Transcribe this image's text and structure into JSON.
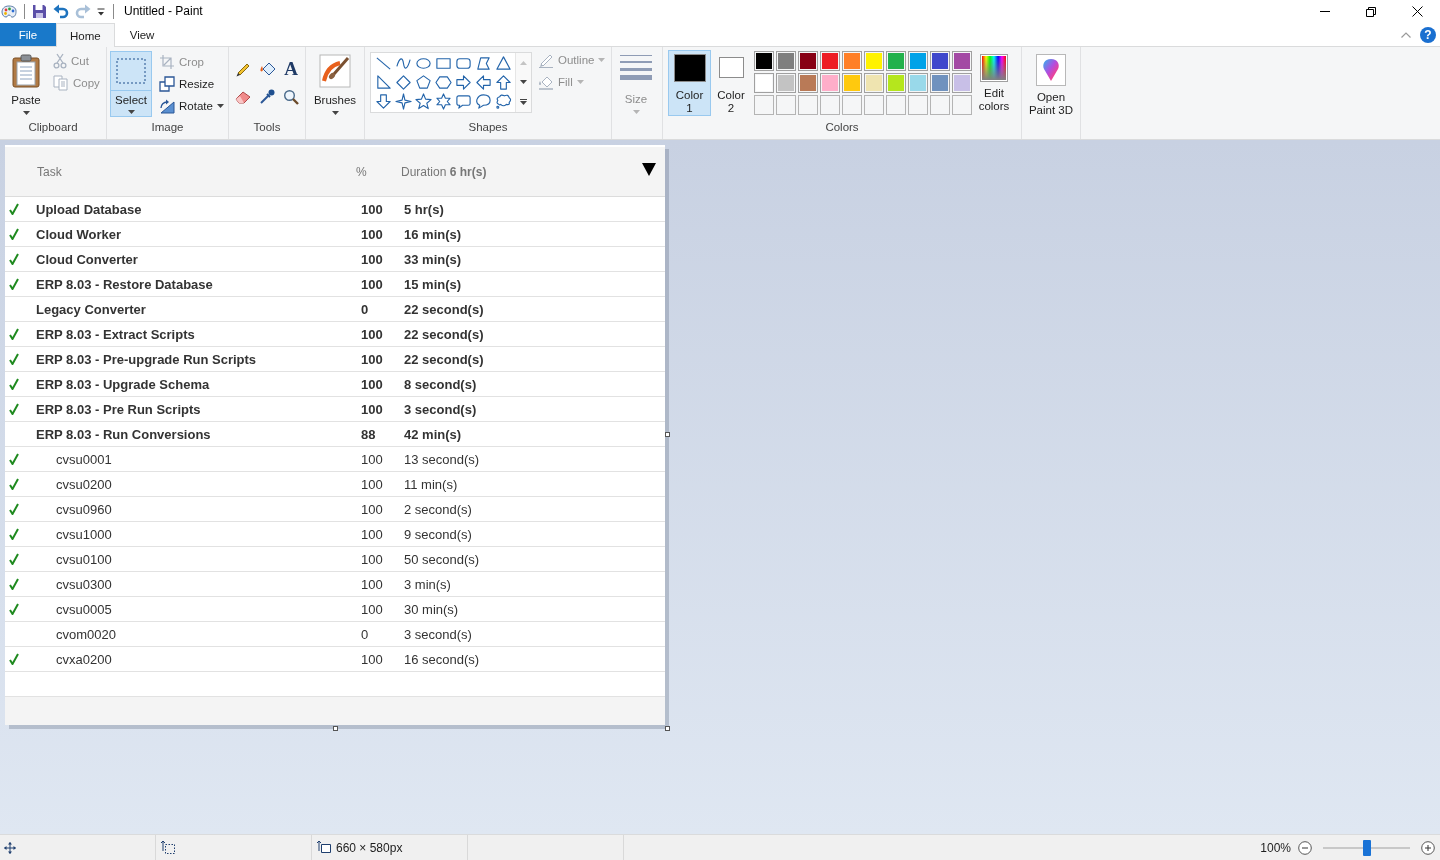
{
  "title_bar": {
    "title": "Untitled - Paint"
  },
  "menu_tabs": [
    {
      "label": "File",
      "kind": "file",
      "selected": false
    },
    {
      "label": "Home",
      "kind": "tab",
      "selected": true
    },
    {
      "label": "View",
      "kind": "tab",
      "selected": false
    }
  ],
  "help": "?",
  "clipboard": {
    "label": "Clipboard",
    "paste": "Paste",
    "tools": [
      {
        "kind": "cut",
        "label": "Cut",
        "disabled": true
      },
      {
        "kind": "copy",
        "label": "Copy",
        "disabled": true
      }
    ]
  },
  "image": {
    "label": "Image",
    "select": {
      "label": "Select",
      "selected": true
    },
    "tools": [
      {
        "kind": "crop",
        "label": "Crop",
        "disabled": true
      },
      {
        "kind": "resize",
        "label": "Resize",
        "disabled": false
      },
      {
        "kind": "rotate",
        "label": "Rotate",
        "disabled": false
      }
    ]
  },
  "tools": {
    "label": "Tools",
    "text_tool": "A"
  },
  "brushes": {
    "label": "Brushes"
  },
  "shapes": {
    "label": "Shapes",
    "options": [
      {
        "kind": "outline",
        "label": "Outline",
        "disabled": true
      },
      {
        "kind": "fill",
        "label": "Fill",
        "disabled": true
      }
    ]
  },
  "size": {
    "label": "Size",
    "disabled": true
  },
  "colors": {
    "label": "Colors",
    "current": [
      {
        "label": "Color 1",
        "color": "#000000",
        "selected": true
      },
      {
        "label": "Color 2",
        "color": "#ffffff",
        "selected": false
      }
    ],
    "palette": [
      {
        "color": "#000000"
      },
      {
        "color": "#7f7f7f"
      },
      {
        "color": "#880015"
      },
      {
        "color": "#ed1c24"
      },
      {
        "color": "#ff7f27"
      },
      {
        "color": "#fff200"
      },
      {
        "color": "#22b14c"
      },
      {
        "color": "#00a2e8"
      },
      {
        "color": "#3f48cc"
      },
      {
        "color": "#a349a4"
      },
      {
        "color": "#ffffff"
      },
      {
        "color": "#c3c3c3"
      },
      {
        "color": "#b97a57"
      },
      {
        "color": "#ffaec9"
      },
      {
        "color": "#ffc90e"
      },
      {
        "color": "#efe4b0"
      },
      {
        "color": "#b5e61d"
      },
      {
        "color": "#99d9ea"
      },
      {
        "color": "#7092be"
      },
      {
        "color": "#c8bfe7"
      }
    ],
    "edit": "Edit colors"
  },
  "paint3d": {
    "label": "Open Paint 3D"
  },
  "canvas": {
    "columns": [
      {
        "kind": "task",
        "label": "Task"
      },
      {
        "kind": "percent",
        "label": "%"
      },
      {
        "kind": "duration",
        "label": "Duration **6 hr(s)**"
      }
    ],
    "rows": [
      {
        "task": "Upload Database",
        "percent": "100",
        "duration": "5 hr(s)",
        "done": true
      },
      {
        "task": "Cloud Worker",
        "percent": "100",
        "duration": "16 min(s)",
        "done": true
      },
      {
        "task": "Cloud Converter",
        "percent": "100",
        "duration": "33 min(s)",
        "done": true
      },
      {
        "task": "ERP 8.03 - Restore Database",
        "percent": "100",
        "duration": "15 min(s)",
        "done": true
      },
      {
        "task": "Legacy Converter",
        "percent": "0",
        "duration": "22 second(s)",
        "done": false
      },
      {
        "task": "ERP 8.03 - Extract Scripts",
        "percent": "100",
        "duration": "22 second(s)",
        "done": true
      },
      {
        "task": "ERP 8.03 - Pre-upgrade Run Scripts",
        "percent": "100",
        "duration": "22 second(s)",
        "done": true
      },
      {
        "task": "ERP 8.03 - Upgrade Schema",
        "percent": "100",
        "duration": "8 second(s)",
        "done": true
      },
      {
        "task": "ERP 8.03 - Pre Run Scripts",
        "percent": "100",
        "duration": "3 second(s)",
        "done": true
      },
      {
        "task": "ERP 8.03 - Run Conversions",
        "percent": "88",
        "duration": "42 min(s)",
        "done": false,
        "children": [
          {
            "task": "cvsu0001",
            "percent": "100",
            "duration": "13 second(s)",
            "done": true
          },
          {
            "task": "cvsu0200",
            "percent": "100",
            "duration": "11 min(s)",
            "done": true
          },
          {
            "task": "cvsu0960",
            "percent": "100",
            "duration": "2 second(s)",
            "done": true
          },
          {
            "task": "cvsu1000",
            "percent": "100",
            "duration": "9 second(s)",
            "done": true
          },
          {
            "task": "cvsu0100",
            "percent": "100",
            "duration": "50 second(s)",
            "done": true
          },
          {
            "task": "cvsu0300",
            "percent": "100",
            "duration": "3 min(s)",
            "done": true
          },
          {
            "task": "cvsu0005",
            "percent": "100",
            "duration": "30 min(s)",
            "done": true
          },
          {
            "task": "cvom0020",
            "percent": "0",
            "duration": "3 second(s)",
            "done": false
          },
          {
            "task": "cvxa0200",
            "percent": "100",
            "duration": "16 second(s)",
            "done": true
          }
        ]
      }
    ]
  },
  "status_bar": {
    "canvas_size": "660 × 580px",
    "zoom": "100%",
    "zoom_slider": {
      "level": 0.5
    }
  }
}
